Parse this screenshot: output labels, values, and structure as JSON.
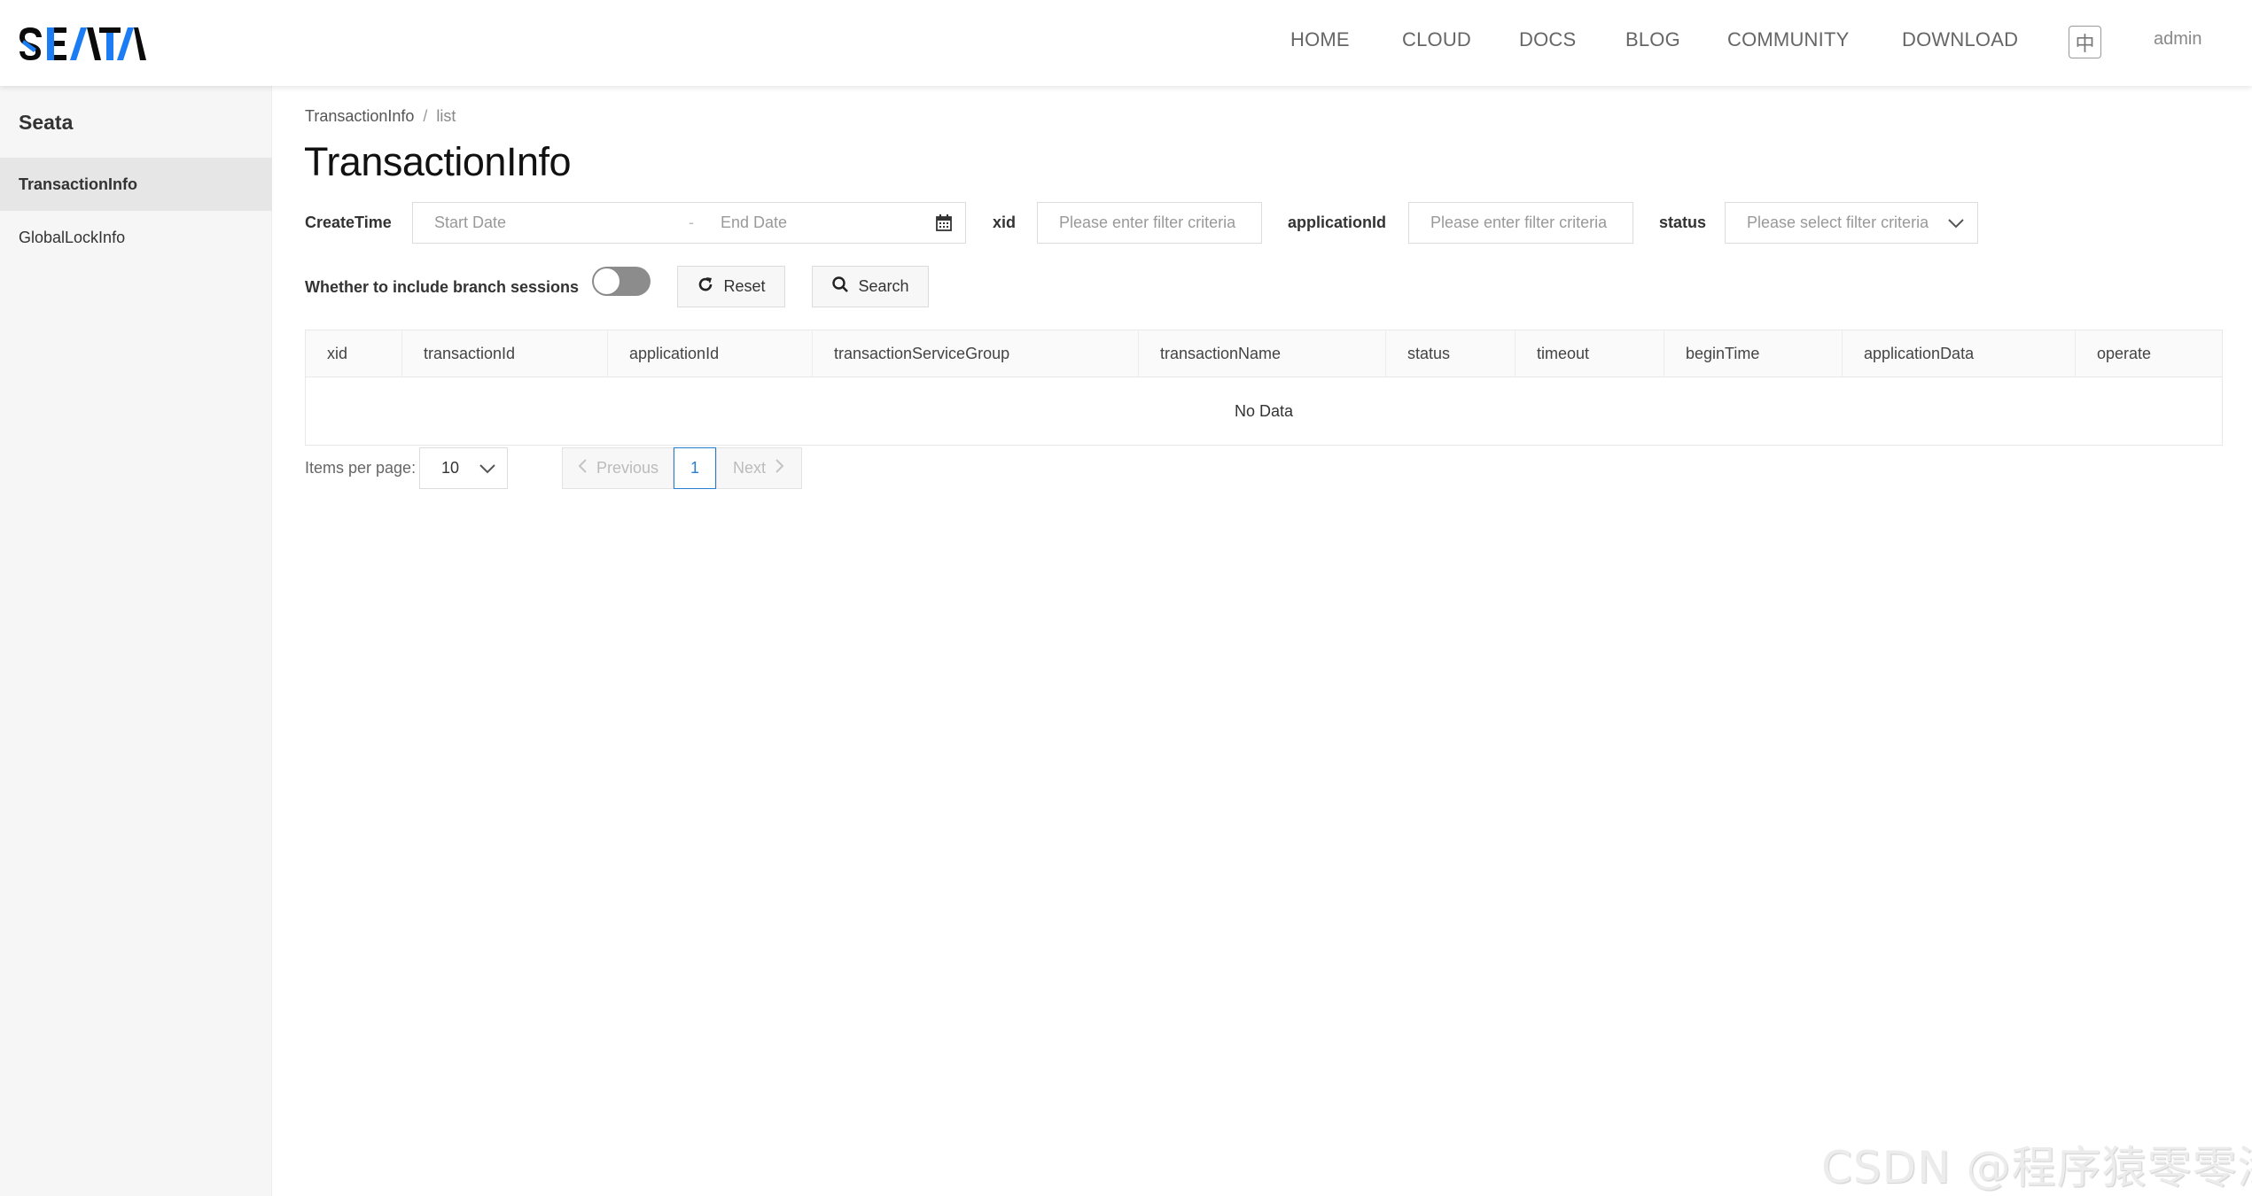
{
  "brand": {
    "logo_text": "SEATA",
    "colors": {
      "dark": "#0b0b0b",
      "accent": "#1b7cf3"
    }
  },
  "nav": {
    "items": [
      {
        "label": "HOME"
      },
      {
        "label": "CLOUD"
      },
      {
        "label": "DOCS"
      },
      {
        "label": "BLOG"
      },
      {
        "label": "COMMUNITY"
      },
      {
        "label": "DOWNLOAD"
      }
    ],
    "language_toggle": "中",
    "user": "admin"
  },
  "sidebar": {
    "title": "Seata",
    "items": [
      {
        "label": "TransactionInfo",
        "active": true
      },
      {
        "label": "GlobalLockInfo",
        "active": false
      }
    ]
  },
  "breadcrumb": {
    "items": [
      "TransactionInfo",
      "list"
    ],
    "separator": "/"
  },
  "page": {
    "title": "TransactionInfo"
  },
  "filters": {
    "create_time": {
      "label": "CreateTime",
      "start_placeholder": "Start Date",
      "separator": "-",
      "end_placeholder": "End Date",
      "icon": "calendar-icon"
    },
    "xid": {
      "label": "xid",
      "placeholder": "Please enter filter criteria",
      "value": ""
    },
    "application_id": {
      "label": "applicationId",
      "placeholder": "Please enter filter criteria",
      "value": ""
    },
    "status": {
      "label": "status",
      "placeholder": "Please select filter criteria",
      "value": ""
    },
    "branch_sessions": {
      "label": "Whether to include branch sessions",
      "enabled": false
    },
    "reset_label": "Reset",
    "search_label": "Search"
  },
  "table": {
    "columns": [
      "xid",
      "transactionId",
      "applicationId",
      "transactionServiceGroup",
      "transactionName",
      "status",
      "timeout",
      "beginTime",
      "applicationData",
      "operate"
    ],
    "rows": [],
    "empty_text": "No Data"
  },
  "pagination": {
    "items_per_page_label": "Items per page:",
    "page_size": "10",
    "previous_label": "Previous",
    "next_label": "Next",
    "current_page": "1",
    "accent_color": "#2a7ed1"
  },
  "watermark": "CSDN @程序猿零零漆"
}
